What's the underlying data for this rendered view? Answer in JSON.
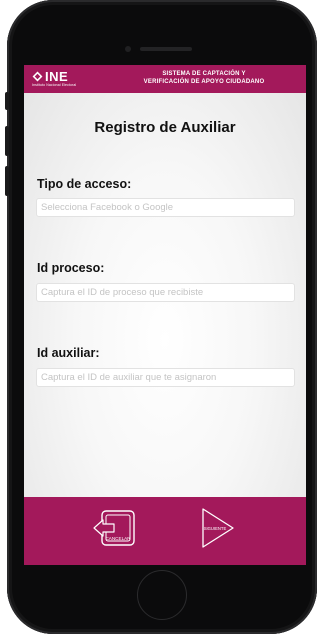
{
  "header": {
    "logo_text": "INE",
    "logo_subtext": "Instituto Nacional Electoral",
    "title_line1": "SISTEMA DE CAPTACIÓN Y",
    "title_line2": "VERIFICACIÓN DE APOYO CIUDADANO"
  },
  "main": {
    "title": "Registro de Auxiliar",
    "fields": [
      {
        "label": "Tipo de acceso:",
        "placeholder": "Selecciona Facebook o Google",
        "value": ""
      },
      {
        "label": "Id proceso:",
        "placeholder": "Captura el ID de proceso que recibiste",
        "value": ""
      },
      {
        "label": "Id auxiliar:",
        "placeholder": "Captura el ID de auxiliar que te asignaron",
        "value": ""
      }
    ]
  },
  "footer": {
    "cancel_label": "CANCELAR",
    "next_label": "SIGUIENTE"
  },
  "colors": {
    "brand": "#a3195b",
    "phone_body": "#0b0b0c"
  },
  "icons": {
    "cancel": "exit-door-icon",
    "next": "play-triangle-icon"
  }
}
